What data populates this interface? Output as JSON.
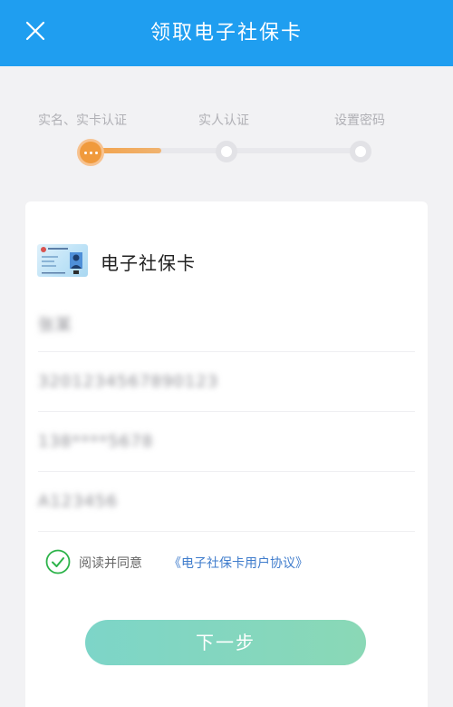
{
  "header": {
    "title": "领取电子社保卡",
    "close_icon": "close-icon",
    "background": "#1f9ef0"
  },
  "stepper": {
    "current_step": 1,
    "steps": [
      {
        "label": "实名、实卡认证",
        "state": "active"
      },
      {
        "label": "实人认证",
        "state": "pending"
      },
      {
        "label": "设置密码",
        "state": "pending"
      }
    ],
    "active_color": "#f09a3c"
  },
  "card": {
    "title": "电子社保卡",
    "thumbnail_icon": "social-security-card-icon",
    "fields": [
      {
        "name": "name",
        "value": "张某"
      },
      {
        "name": "id-number",
        "value": "3201234567890123"
      },
      {
        "name": "phone",
        "value": "138****5678"
      },
      {
        "name": "card-number",
        "value": "A123456"
      }
    ]
  },
  "agreement": {
    "checked": true,
    "prefix_text": "阅读并同意",
    "link_text": "《电子社保卡用户协议》",
    "check_color": "#2db34a",
    "link_color": "#3f7ccc"
  },
  "actions": {
    "next_label": "下一步"
  }
}
